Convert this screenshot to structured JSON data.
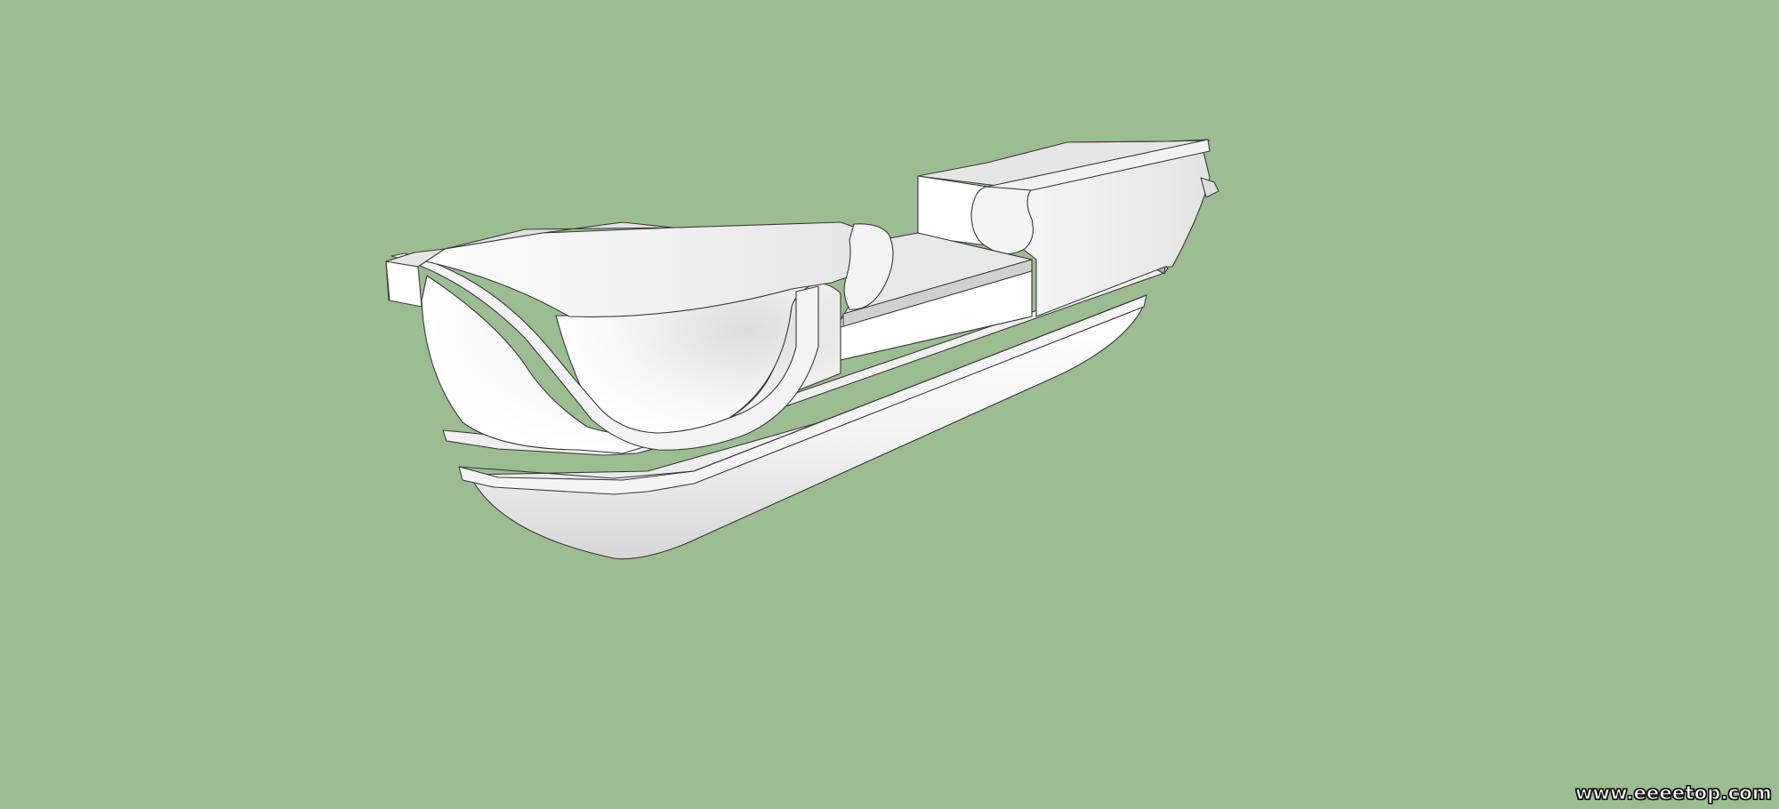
{
  "canvas": {
    "background_color": "#9bbd91"
  },
  "model": {
    "face_color": "#ffffff",
    "shade_color": "#cfcfcf",
    "edge_color": "#3a3a3a"
  },
  "watermark": {
    "text": "www.eeeetop.com"
  }
}
